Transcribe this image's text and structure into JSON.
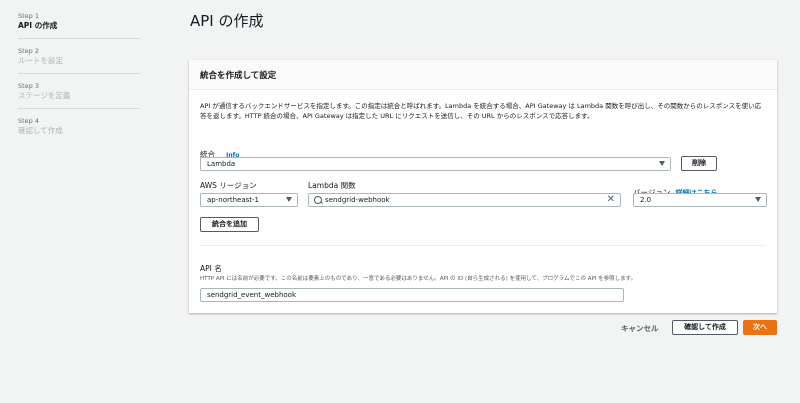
{
  "steps": [
    {
      "num": "Step 1",
      "title": "API の作成",
      "active": true
    },
    {
      "num": "Step 2",
      "title": "ルートを設定",
      "active": false
    },
    {
      "num": "Step 3",
      "title": "ステージを定義",
      "active": false
    },
    {
      "num": "Step 4",
      "title": "確認して作成",
      "active": false
    }
  ],
  "page_title": "API の作成",
  "panel": {
    "header": "統合を作成して設定",
    "description": "API が通信するバックエンドサービスを指定します。この指定は統合と呼ばれます。Lambda を統合する場合、API Gateway は Lambda 関数を呼び出し、その関数からのレスポンスを使い応答を返します。HTTP 統合の場合、API Gateway は指定した URL にリクエストを送信し、その URL からのレスポンスで応答します。",
    "integration_label": "統合",
    "info_label": "Info",
    "integration_value": "Lambda",
    "remove_label": "削除",
    "region_label": "AWS リージョン",
    "region_value": "ap-northeast-1",
    "function_label": "Lambda 関数",
    "function_value": "sendgrid-webhook",
    "version_label": "バージョン",
    "version_link": "詳細はこちら。",
    "version_value": "2.0",
    "add_integration_label": "統合を追加",
    "api_name_label": "API 名",
    "api_name_hint": "HTTP API には名前が必要です。この名前は要素上のものであり、一意である必要はありません。API の ID (自ら生成される) を使用して、プログラムでこの API を参照します。",
    "api_name_value": "sendgrid_event_webhook"
  },
  "footer": {
    "cancel_label": "キャンセル",
    "confirm_label": "確認して作成",
    "next_label": "次へ"
  },
  "colors": {
    "accent": "#ec7211",
    "link": "#0073bb"
  }
}
